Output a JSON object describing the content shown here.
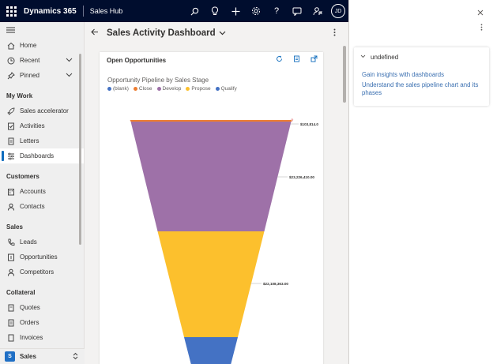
{
  "app": {
    "brand": "Dynamics 365",
    "name": "Sales Hub",
    "user_initials": "JD"
  },
  "icons": {
    "search": "search-icon",
    "lightbulb": "lightbulb-icon",
    "add": "plus-icon",
    "settings": "gear-icon",
    "help": "question-icon",
    "chat": "chat-icon",
    "assist": "person-flag-icon"
  },
  "sidebar": {
    "top_items": [
      {
        "label": "Home",
        "icon": "home-icon"
      },
      {
        "label": "Recent",
        "icon": "clock-icon"
      },
      {
        "label": "Pinned",
        "icon": "pin-icon"
      }
    ],
    "sections": [
      {
        "title": "My Work",
        "items": [
          {
            "label": "Sales accelerator",
            "icon": "rocket-icon"
          },
          {
            "label": "Activities",
            "icon": "activities-icon"
          },
          {
            "label": "Letters",
            "icon": "document-icon"
          },
          {
            "label": "Dashboards",
            "icon": "dashboard-icon"
          }
        ]
      },
      {
        "title": "Customers",
        "items": [
          {
            "label": "Accounts",
            "icon": "building-icon"
          },
          {
            "label": "Contacts",
            "icon": "person-icon"
          }
        ]
      },
      {
        "title": "Sales",
        "items": [
          {
            "label": "Leads",
            "icon": "phone-icon"
          },
          {
            "label": "Opportunities",
            "icon": "opportunity-icon"
          },
          {
            "label": "Competitors",
            "icon": "competitor-icon"
          }
        ]
      },
      {
        "title": "Collateral",
        "items": [
          {
            "label": "Quotes",
            "icon": "quote-icon"
          },
          {
            "label": "Orders",
            "icon": "order-icon"
          },
          {
            "label": "Invoices",
            "icon": "invoice-icon"
          }
        ]
      }
    ],
    "area": {
      "badge": "S",
      "label": "Sales"
    }
  },
  "main": {
    "dashboard_title": "Sales Activity Dashboard",
    "card_title": "Open Opportunities"
  },
  "right_pane": {
    "section_title": "undefined",
    "links": [
      "Gain insights with dashboards",
      "Understand the sales pipeline chart and its phases"
    ]
  },
  "chart_data": {
    "type": "funnel",
    "title": "Opportunity Pipeline by Sales Stage",
    "legend": [
      {
        "name": "(blank)",
        "color": "#4472c4"
      },
      {
        "name": "Close",
        "color": "#ed7d31"
      },
      {
        "name": "Develop",
        "color": "#9e71a8"
      },
      {
        "name": "Propose",
        "color": "#fcc02d"
      },
      {
        "name": "Qualify",
        "color": "#4472c4"
      }
    ],
    "stages": [
      {
        "name": "Close",
        "value": 103814,
        "label": "$103,814.0",
        "color": "#ed7d31"
      },
      {
        "name": "Develop",
        "value": 23226410,
        "label": "$23,226,410.00",
        "color": "#9e71a8"
      },
      {
        "name": "Propose",
        "value": 22108363,
        "label": "$22,108,363.00",
        "color": "#fcc02d"
      },
      {
        "name": "Qualify",
        "value": null,
        "label": "",
        "color": "#4472c4"
      }
    ]
  }
}
